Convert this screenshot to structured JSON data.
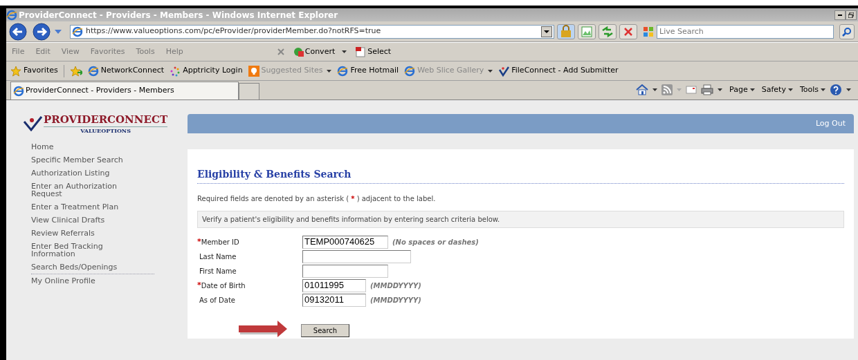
{
  "window": {
    "title": "ProviderConnect - Providers - Members - Windows Internet Explorer"
  },
  "address_bar": {
    "url": "https://www.valueoptions.com/pc/eProvider/providerMember.do?notRFS=true"
  },
  "search": {
    "placeholder": "Live Search"
  },
  "menu": [
    "File",
    "Edit",
    "View",
    "Favorites",
    "Tools",
    "Help"
  ],
  "toolbar": [
    "Convert",
    "Select"
  ],
  "favorites_bar": {
    "label": "Favorites",
    "items": [
      {
        "label": "NetworkConnect",
        "kind": "ie",
        "dimmed": false,
        "dropdown": false
      },
      {
        "label": "Apptricity Login",
        "kind": "dots",
        "dimmed": false,
        "dropdown": false
      },
      {
        "label": "Suggested Sites",
        "kind": "bulb",
        "dimmed": true,
        "dropdown": true
      },
      {
        "label": "Free Hotmail",
        "kind": "ie",
        "dimmed": false,
        "dropdown": false
      },
      {
        "label": "Web Slice Gallery",
        "kind": "ie",
        "dimmed": true,
        "dropdown": true
      },
      {
        "label": "FileConnect - Add Submitter",
        "kind": "check",
        "dimmed": false,
        "dropdown": false
      }
    ]
  },
  "tabs": [
    {
      "label": "ProviderConnect - Providers - Members",
      "selected": true
    }
  ],
  "command_bar": [
    "Page",
    "Safety",
    "Tools"
  ],
  "site": {
    "logo": "PROVIDERCONNECT",
    "logo_sub": "VALUEOPTIONS",
    "logout": "Log Out"
  },
  "sidebar": {
    "items": [
      {
        "label": "Home"
      },
      {
        "label": "Specific Member Search"
      },
      {
        "label": "Authorization Listing"
      },
      {
        "label": "Enter an Authorization Request"
      },
      {
        "label": "Enter a Treatment Plan"
      },
      {
        "label": "View Clinical Drafts"
      },
      {
        "label": "Review Referrals"
      },
      {
        "label": "Enter Bed Tracking Information"
      },
      {
        "label": "Search Beds/Openings"
      },
      {
        "label": "My Online Profile"
      }
    ]
  },
  "form": {
    "title": "Eligibility & Benefits Search",
    "required_note": {
      "before": "Required fields are denoted by an asterisk (",
      "marker": "*",
      "after": ") adjacent to the label."
    },
    "instructions": "Verify a patient's eligibility and benefits information by entering search criteria below.",
    "fields": [
      {
        "label": "Member ID",
        "required": true,
        "value": "TEMP000740625",
        "hint": "(No spaces or dashes)"
      },
      {
        "label": "Last Name",
        "required": false
      },
      {
        "label": "First Name",
        "required": false
      },
      {
        "label": "Date of Birth",
        "required": true,
        "value": "01011995",
        "hint": "(MMDDYYYY)"
      },
      {
        "label": "As of Date",
        "required": false,
        "value": "09132011",
        "hint": "(MMDDYYYY)"
      }
    ],
    "submit": "Search"
  }
}
